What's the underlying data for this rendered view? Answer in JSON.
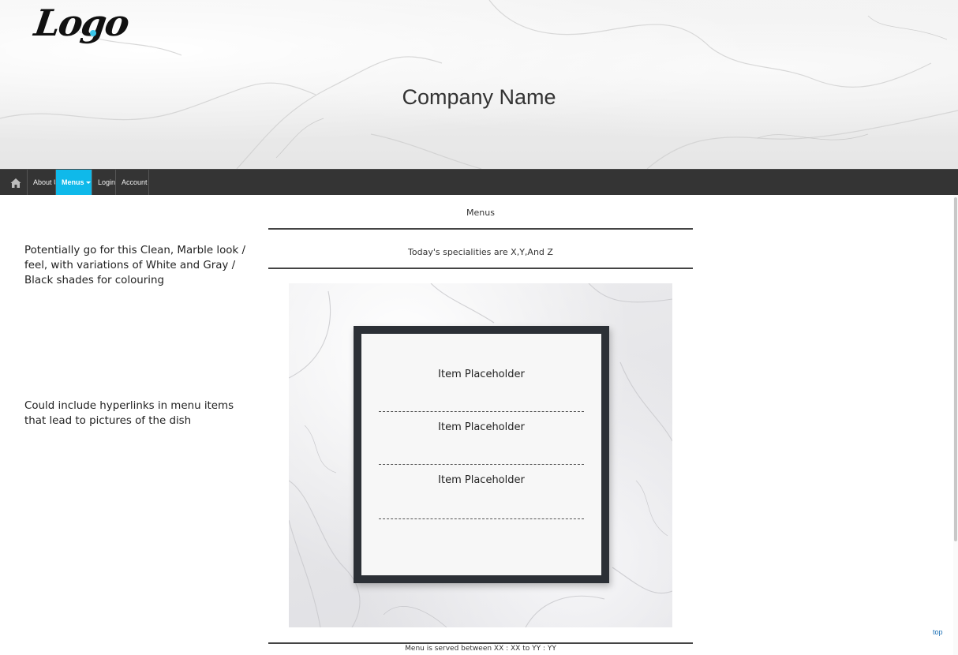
{
  "header": {
    "logo_text": "Logo",
    "company_name": "Company Name"
  },
  "nav": {
    "home_icon": "home-icon",
    "items": [
      {
        "label": "About Us"
      },
      {
        "label": "Menus"
      },
      {
        "label": "Login"
      },
      {
        "label": "Account"
      }
    ],
    "active_item": "Menus",
    "bar_color": "#343434",
    "accent_color": "#0fb9ea"
  },
  "notes": {
    "note_1": "Potentially go for this Clean, Marble look / feel, with variations of White and Gray / Black shades for colouring",
    "note_2": "Could include hyperlinks in menu items that lead to pictures of the dish"
  },
  "main": {
    "menus_title": "Menus",
    "specialities": "Today's specialities are X,Y,And Z",
    "items": [
      {
        "label": "Item Placeholder"
      },
      {
        "label": "Item Placeholder"
      },
      {
        "label": "Item Placeholder"
      }
    ],
    "served_hours": "Menu is served between XX : XX to YY : YY"
  },
  "footer": {
    "top_link": "top"
  }
}
